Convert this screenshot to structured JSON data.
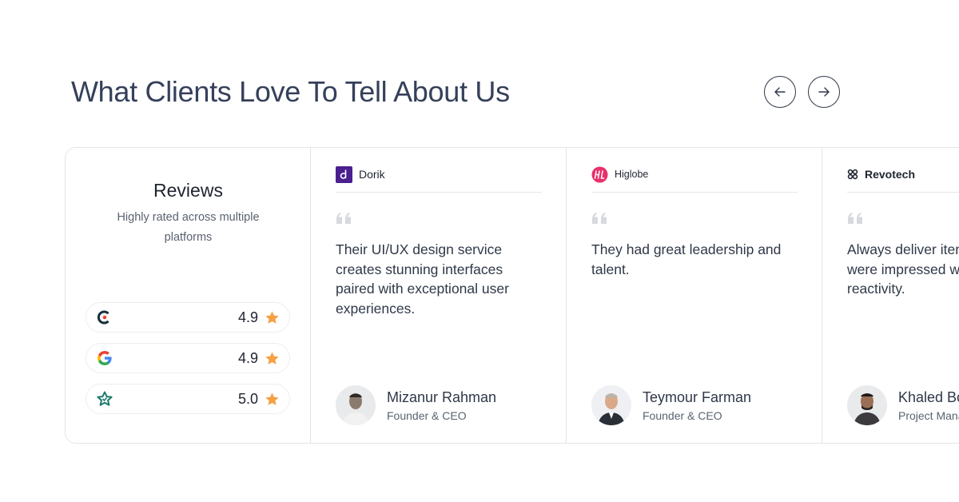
{
  "header": {
    "title": "What Clients Love To Tell About Us",
    "prev_icon": "arrow-left-icon",
    "next_icon": "arrow-right-icon"
  },
  "summary": {
    "title": "Reviews",
    "subtitle": "Highly rated across multiple platforms",
    "platforms": [
      {
        "logo": "clutch-logo",
        "rating": "4.9"
      },
      {
        "logo": "google-logo",
        "rating": "4.9"
      },
      {
        "logo": "goodfirms-logo",
        "rating": "5.0"
      }
    ],
    "star_color": "#f5a044"
  },
  "testimonials": [
    {
      "company": "Dorik",
      "company_logo": "dorik-logo",
      "quote": "Their UI/UX design service creates stunning interfaces paired with exceptional user experiences.",
      "author": "Mizanur Rahman",
      "role": "Founder & CEO"
    },
    {
      "company": "Higlobe",
      "company_logo": "higlobe-logo",
      "quote": "They had great leadership and talent.",
      "author": "Teymour Farman",
      "role": "Founder & CEO"
    },
    {
      "company": "Revotech",
      "company_logo": "revotech-logo",
      "quote": "Always deliver items on time. We were impressed with their reactivity.",
      "author": "Khaled Bou",
      "role": "Project Manager"
    }
  ],
  "colors": {
    "text": "#2f3848",
    "border": "#e3e6ea",
    "dorik": "#4b1f8f",
    "higlobe": "#e8306b"
  }
}
